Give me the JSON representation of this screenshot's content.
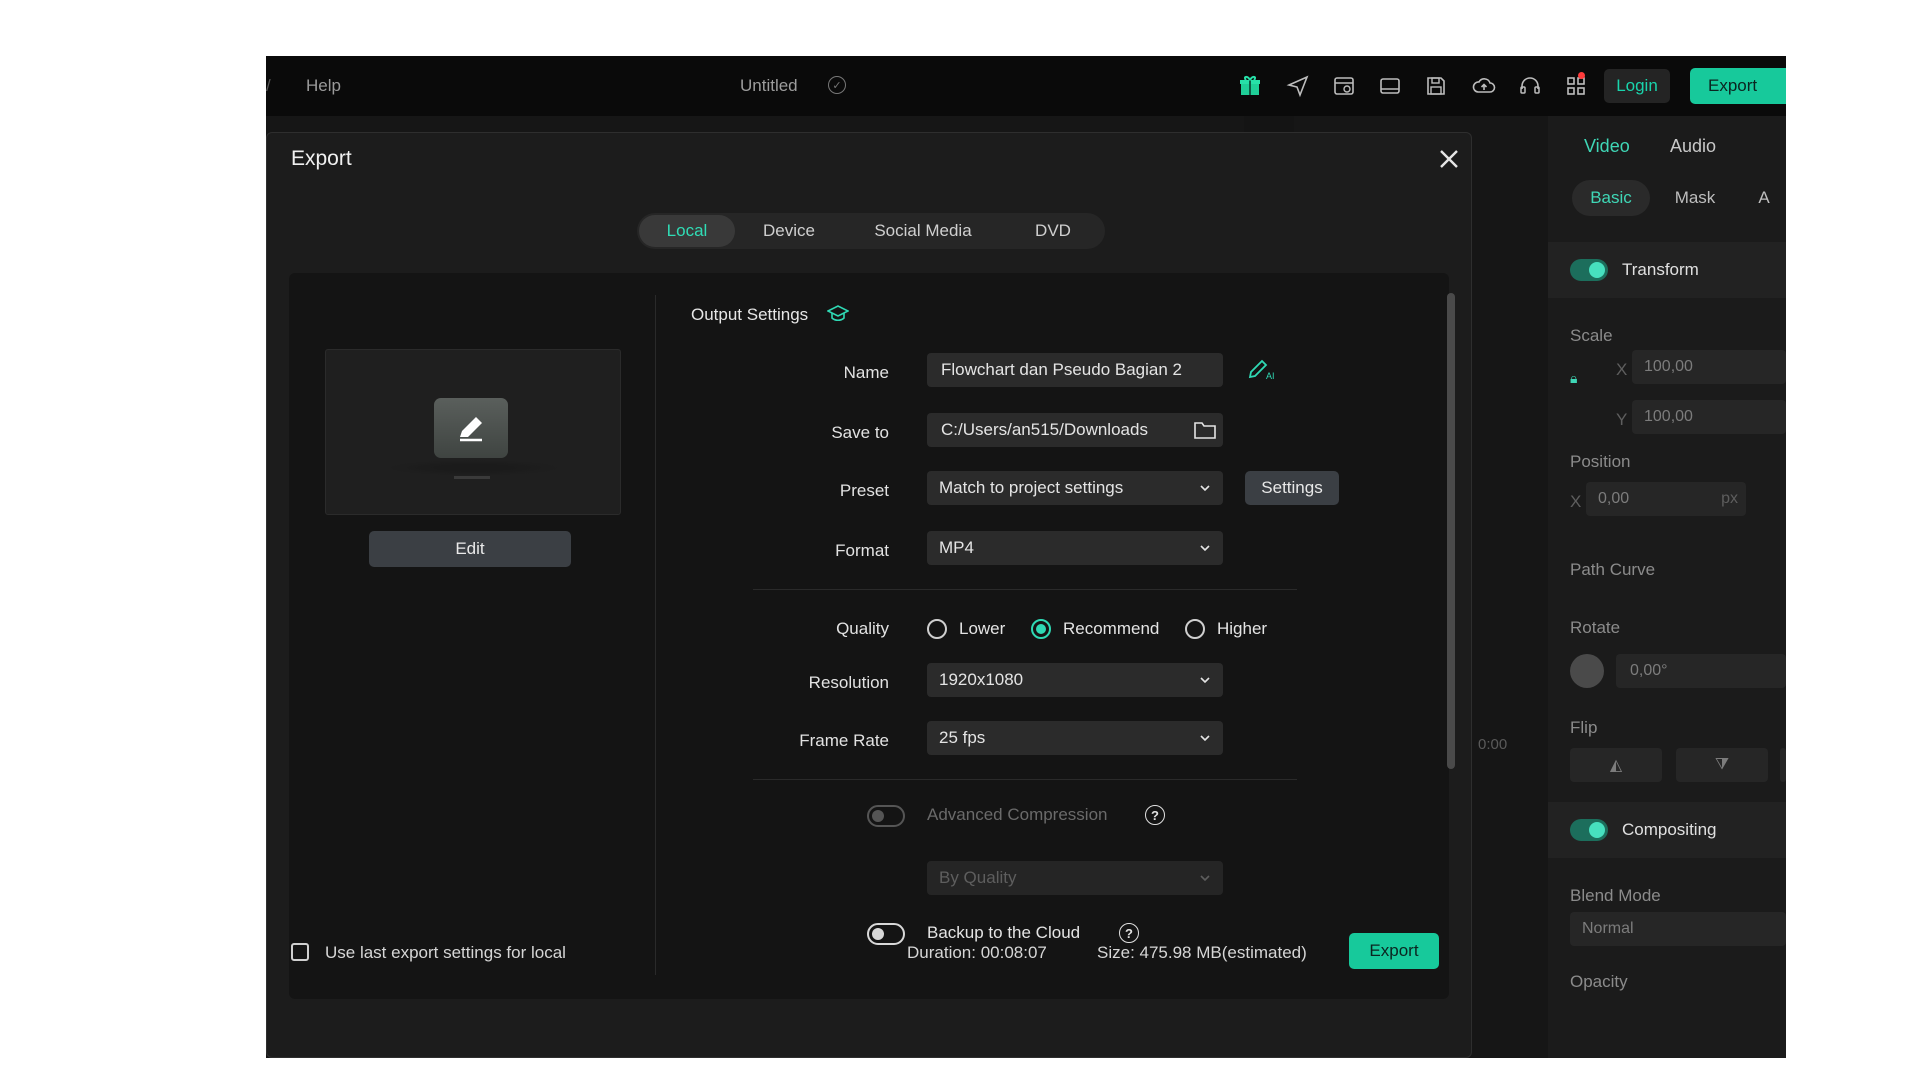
{
  "menu": {
    "separator": "/",
    "help": "Help"
  },
  "project": {
    "title": "Untitled"
  },
  "topbar": {
    "login_label": "Login",
    "export_label": "Export"
  },
  "properties": {
    "tabs": [
      "Video",
      "Audio"
    ],
    "subtabs": [
      "Basic",
      "Mask",
      "A"
    ],
    "transform_label": "Transform",
    "scale_label": "Scale",
    "scale_x_label": "X",
    "scale_x": "100,00",
    "scale_y_label": "Y",
    "scale_y": "100,00",
    "position_label": "Position",
    "position_x_label": "X",
    "position_x": "0,00",
    "position_unit": "px",
    "path_curve_label": "Path Curve",
    "rotate_label": "Rotate",
    "rotate_value": "0,00°",
    "flip_label": "Flip",
    "compositing_label": "Compositing",
    "blend_mode_label": "Blend Mode",
    "blend_mode_value": "Normal",
    "opacity_label": "Opacity"
  },
  "background": {
    "timecode": "0:00"
  },
  "dialog": {
    "title": "Export",
    "tabs": [
      "Local",
      "Device",
      "Social Media",
      "DVD"
    ],
    "active_tab": "Local",
    "edit_label": "Edit",
    "output_settings_label": "Output Settings",
    "name_label": "Name",
    "name_value": "Flowchart dan Pseudo Bagian 2",
    "save_to_label": "Save to",
    "save_to_value": "C:/Users/an515/Downloads",
    "preset_label": "Preset",
    "preset_value": "Match to project settings",
    "settings_label": "Settings",
    "format_label": "Format",
    "format_value": "MP4",
    "quality_label": "Quality",
    "quality_options": [
      "Lower",
      "Recommend",
      "Higher"
    ],
    "quality_selected": "Recommend",
    "resolution_label": "Resolution",
    "resolution_value": "1920x1080",
    "frame_rate_label": "Frame Rate",
    "frame_rate_value": "25 fps",
    "advanced_compression_label": "Advanced Compression",
    "advanced_compression_on": false,
    "compression_mode_value": "By Quality",
    "backup_label": "Backup to the Cloud",
    "backup_on": false,
    "help_symbol": "?",
    "use_last_label": "Use last export settings for local",
    "duration_text": "Duration: 00:08:07",
    "size_text": "Size: 475.98 MB(estimated)",
    "export_label": "Export"
  },
  "colors": {
    "accent": "#17c99b",
    "accent_text": "#30dcb5",
    "background": "#1c1c1c"
  }
}
